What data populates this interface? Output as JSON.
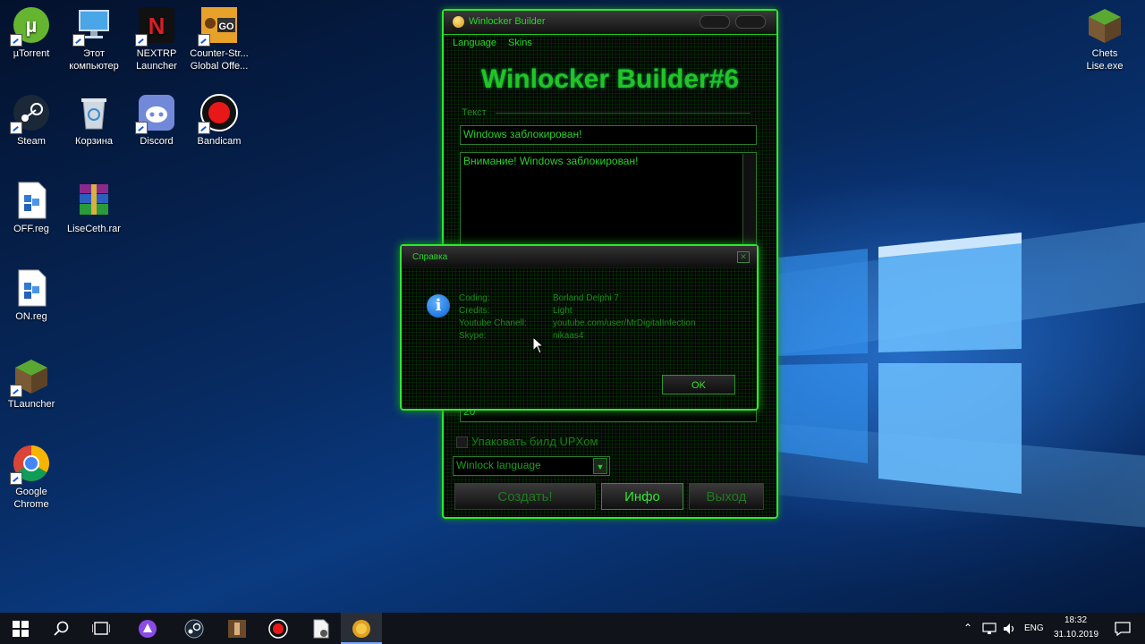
{
  "desktop": {
    "icons": [
      {
        "label": "µTorrent",
        "icon": "utorrent-icon"
      },
      {
        "label": "Этот компьютер",
        "icon": "computer-icon"
      },
      {
        "label": "NEXTRP Launcher",
        "icon": "nextrp-icon"
      },
      {
        "label": "Counter-Str... Global Offe...",
        "icon": "csgo-icon"
      },
      {
        "label": "Chets Lise.exe",
        "icon": "minecraft-block-icon"
      },
      {
        "label": "Steam",
        "icon": "steam-icon"
      },
      {
        "label": "Корзина",
        "icon": "recycle-bin-icon"
      },
      {
        "label": "Discord",
        "icon": "discord-icon"
      },
      {
        "label": "Bandicam",
        "icon": "bandicam-icon"
      },
      {
        "label": "OFF.reg",
        "icon": "registry-file-icon"
      },
      {
        "label": "LiseCeth.rar",
        "icon": "winrar-icon"
      },
      {
        "label": "ON.reg",
        "icon": "registry-file-icon"
      },
      {
        "label": "TLauncher",
        "icon": "tlauncher-icon"
      },
      {
        "label": "Google Chrome",
        "icon": "chrome-icon"
      }
    ]
  },
  "builder": {
    "window_title": "Winlocker Builder",
    "menu": [
      "Language",
      "Skins"
    ],
    "heading": "Winlocker Builder#6",
    "section_label": "Текст",
    "title_field": "Windows заблокирован!",
    "message_field": "Внимание! Windows заблокирован!",
    "number_field": "20",
    "upx_checkbox_label": "Упаковать билд UPXом",
    "language_select": "Winlock language",
    "buttons": {
      "create": "Создать!",
      "info": "Инфо",
      "exit": "Выход"
    }
  },
  "dialog": {
    "title": "Справка",
    "rows": [
      {
        "label": "Coding:",
        "value": "Borland Delphi 7"
      },
      {
        "label": "Credits:",
        "value": "Light"
      },
      {
        "label": "Youtube Chanell:",
        "value": "youtube.com/user/MrDigitalInfection"
      },
      {
        "label": "Skype:",
        "value": "nikaas4"
      }
    ],
    "ok_label": "OK"
  },
  "taskbar": {
    "language": "ENG",
    "time": "18:32",
    "date": "31.10.2019"
  },
  "colors": {
    "accent_green": "#2ee82e",
    "text_green": "#23c423",
    "taskbar_bg": "#10131a"
  }
}
